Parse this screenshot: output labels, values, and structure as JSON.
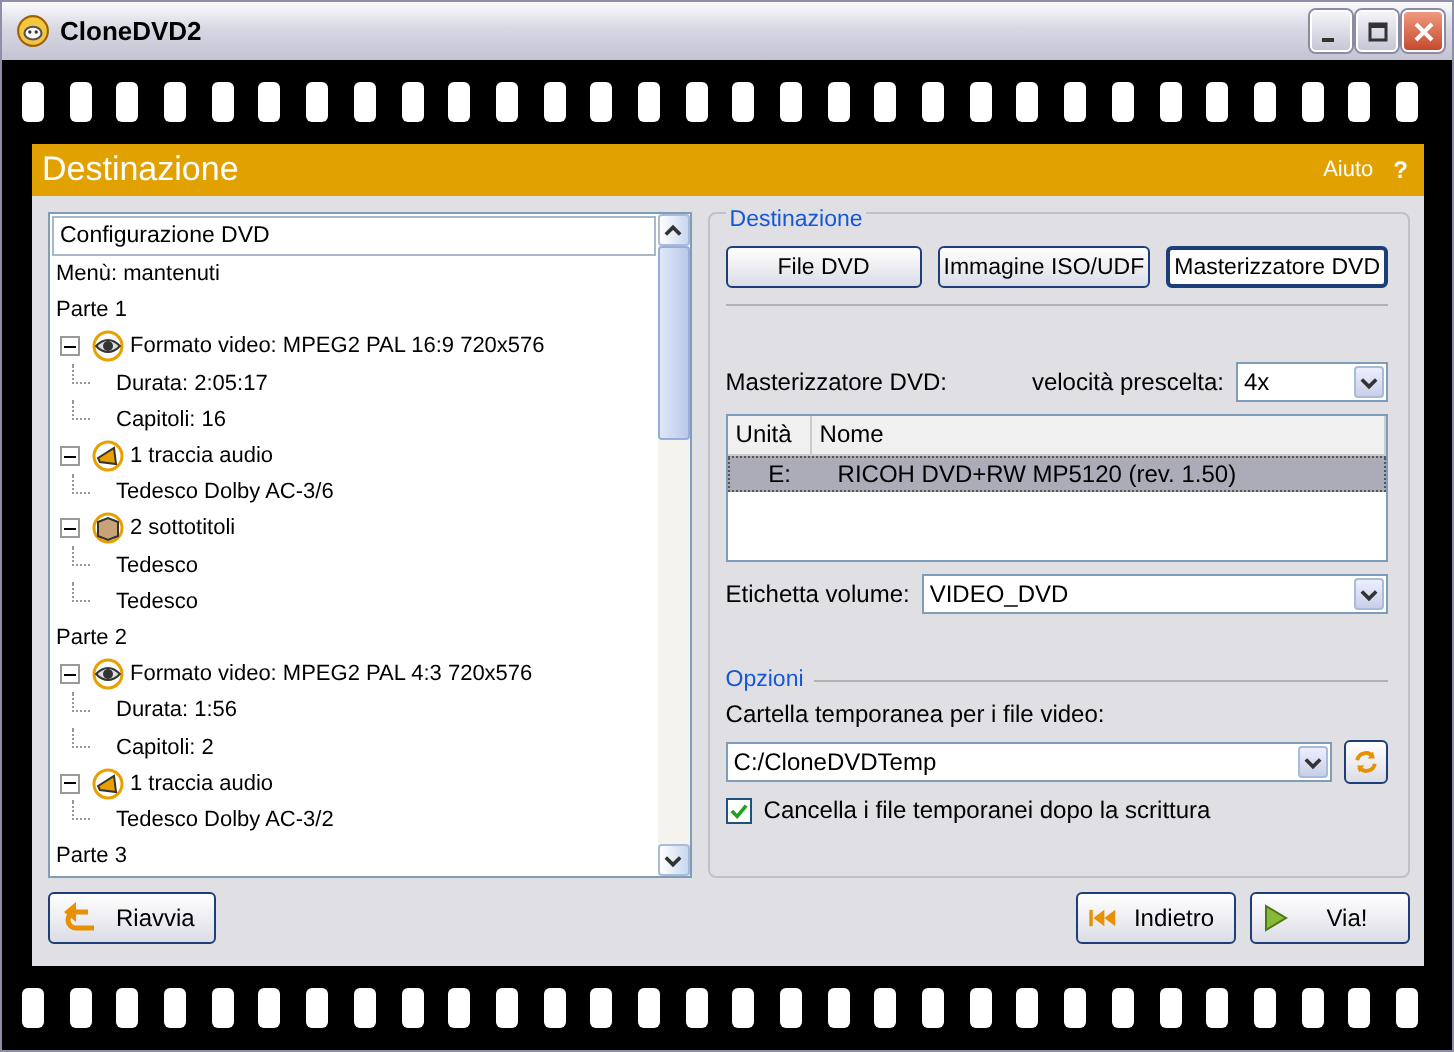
{
  "window": {
    "title": "CloneDVD2"
  },
  "header": {
    "title": "Destinazione",
    "help": "Aiuto",
    "help_mark": "?"
  },
  "tree": {
    "header": "Configurazione DVD",
    "nodes": [
      {
        "label": "Menù: mantenuti"
      },
      {
        "label": "Parte 1",
        "children": [
          {
            "label": "Formato video: MPEG2 PAL 16:9 720x576",
            "kind": "video",
            "expanded": true,
            "children": [
              {
                "label": "Durata: 2:05:17"
              },
              {
                "label": "Capitoli: 16"
              }
            ]
          },
          {
            "label": "1 traccia audio",
            "kind": "audio",
            "expanded": true,
            "children": [
              {
                "label": "Tedesco Dolby AC-3/6"
              }
            ]
          },
          {
            "label": "2 sottotitoli",
            "kind": "subtitles",
            "expanded": true,
            "children": [
              {
                "label": "Tedesco"
              },
              {
                "label": "Tedesco"
              }
            ]
          }
        ]
      },
      {
        "label": "Parte 2",
        "children": [
          {
            "label": "Formato video: MPEG2 PAL  4:3 720x576",
            "kind": "video",
            "expanded": true,
            "children": [
              {
                "label": "Durata: 1:56"
              },
              {
                "label": "Capitoli: 2"
              }
            ]
          },
          {
            "label": "1 traccia audio",
            "kind": "audio",
            "expanded": true,
            "children": [
              {
                "label": "Tedesco Dolby AC-3/2"
              }
            ]
          }
        ]
      },
      {
        "label": "Parte 3"
      }
    ]
  },
  "destination": {
    "legend": "Destinazione",
    "targets": [
      {
        "label": "File DVD",
        "selected": false
      },
      {
        "label": "Immagine ISO/UDF",
        "selected": false
      },
      {
        "label": "Masterizzatore DVD",
        "selected": true
      }
    ],
    "burner_label": "Masterizzatore DVD:",
    "speed_label": "velocità prescelta:",
    "speed": "4x",
    "drives": {
      "columns": [
        "Unità",
        "Nome"
      ],
      "rows": [
        {
          "cells": [
            "E:",
            "RICOH DVD+RW MP5120 (rev. 1.50)"
          ],
          "selected": true
        }
      ]
    },
    "volume_label": "Etichetta volume:",
    "volume": "VIDEO_DVD"
  },
  "options": {
    "legend": "Opzioni",
    "temp_label": "Cartella temporanea per i file video:",
    "temp_folder": "C:/CloneDVDTemp",
    "delete_temp": {
      "label": "Cancella i file temporanei dopo la scrittura",
      "checked": true
    }
  },
  "buttons": {
    "restart": "Riavvia",
    "back": "Indietro",
    "go": "Via!"
  }
}
